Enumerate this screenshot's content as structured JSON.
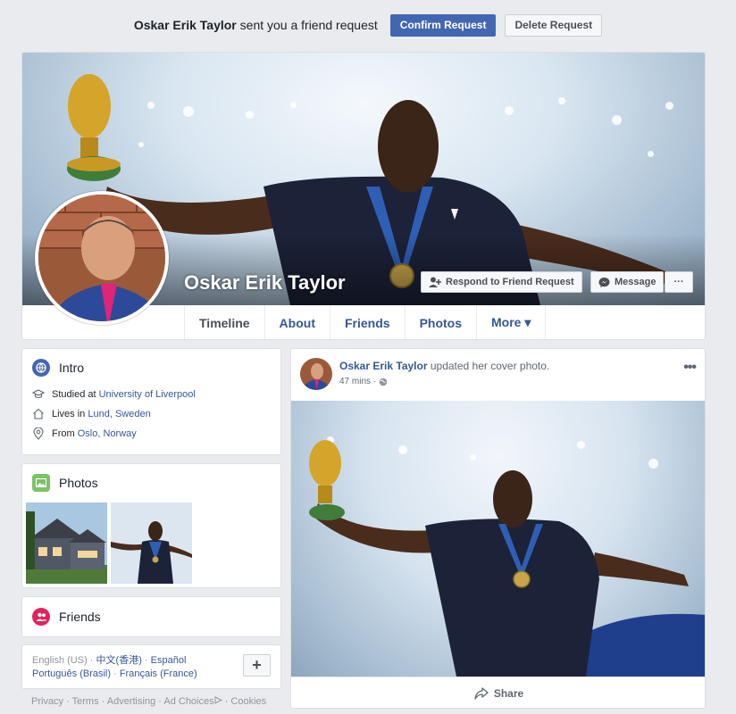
{
  "friend_request": {
    "name": "Oskar Erik Taylor",
    "text": "sent you a friend request",
    "confirm_label": "Confirm Request",
    "delete_label": "Delete Request"
  },
  "profile": {
    "name": "Oskar Erik Taylor",
    "respond_label": "Respond to Friend Request",
    "message_label": "Message",
    "more_glyph": "···",
    "tabs": [
      "Timeline",
      "About",
      "Friends",
      "Photos",
      "More ▾"
    ]
  },
  "intro": {
    "title": "Intro",
    "studied_prefix": "Studied at",
    "studied_value": "University of Liverpool",
    "lives_prefix": "Lives in",
    "lives_value": "Lund, Sweden",
    "from_prefix": "From",
    "from_value": "Oslo, Norway"
  },
  "photos": {
    "title": "Photos"
  },
  "friends": {
    "title": "Friends"
  },
  "languages": {
    "line1_a": "English (US)",
    "line1_b": "中文(香港)",
    "line1_c": "Español",
    "line2_a": "Português (Brasil)",
    "line2_b": "Français (France)",
    "add_glyph": "+"
  },
  "footer": {
    "privacy": "Privacy",
    "terms": "Terms",
    "advertising": "Advertising",
    "ad_choices": "Ad Choices",
    "cookies": "Cookies"
  },
  "post": {
    "author": "Oskar Erik Taylor",
    "action": "updated her cover photo.",
    "time": "47 mins",
    "menu_glyph": "•••",
    "share_label": "Share"
  },
  "colors": {
    "brand": "#4267b2",
    "link": "#365899",
    "intro_icon": "#4267b2",
    "photos_icon": "#7cc366",
    "friends_icon": "#e0245e"
  }
}
